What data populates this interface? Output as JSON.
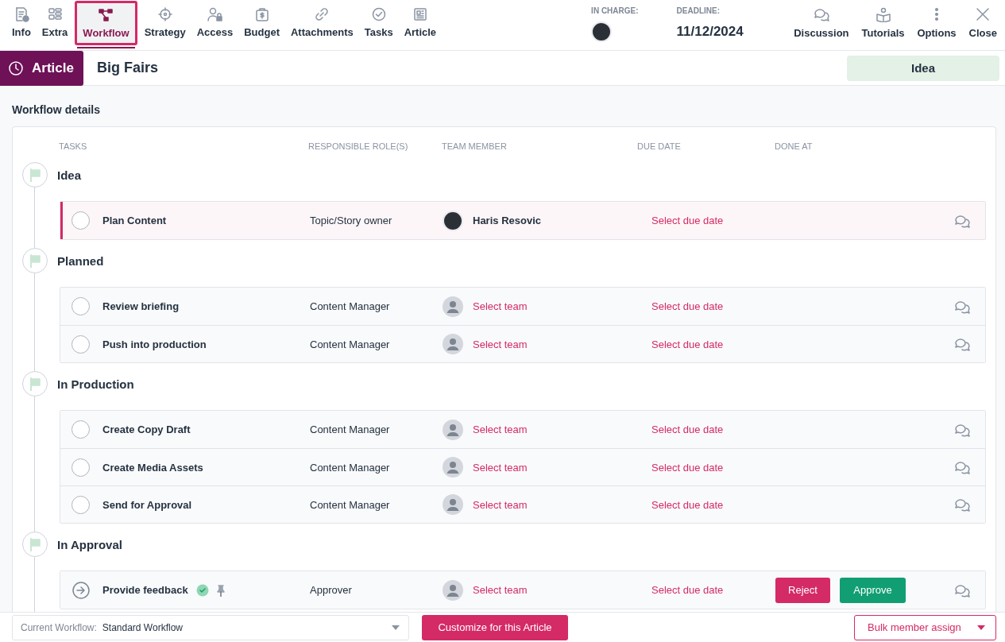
{
  "toolbar": {
    "tabs": [
      {
        "label": "Info",
        "selected": false
      },
      {
        "label": "Extra",
        "selected": false
      },
      {
        "label": "Workflow",
        "selected": true
      },
      {
        "label": "Strategy",
        "selected": false
      },
      {
        "label": "Access",
        "selected": false
      },
      {
        "label": "Budget",
        "selected": false
      },
      {
        "label": "Attachments",
        "selected": false
      },
      {
        "label": "Tasks",
        "selected": false
      },
      {
        "label": "Article",
        "selected": false
      }
    ],
    "in_charge": {
      "label": "IN CHARGE:"
    },
    "deadline": {
      "label": "DEADLINE:",
      "value": "11/12/2024"
    },
    "actions": [
      "Discussion",
      "Tutorials",
      "Options",
      "Close"
    ]
  },
  "title_bar": {
    "type": "Article",
    "title": "Big Fairs",
    "status": "Idea"
  },
  "section_title": "Workflow details",
  "columns": [
    "TASKS",
    "RESPONSIBLE ROLE(S)",
    "TEAM MEMBER",
    "DUE DATE",
    "DONE AT"
  ],
  "stages": [
    {
      "name": "Idea",
      "tasks": [
        {
          "name": "Plan Content",
          "kind": "todo",
          "active": true,
          "role": "Topic/Story owner",
          "member": "Haris Resovic",
          "assigned": true,
          "due": "Select due date"
        }
      ]
    },
    {
      "name": "Planned",
      "tasks": [
        {
          "name": "Review briefing",
          "kind": "todo",
          "active": false,
          "role": "Content Manager",
          "member": "Select team",
          "assigned": false,
          "due": "Select due date"
        },
        {
          "name": "Push into production",
          "kind": "todo",
          "active": false,
          "role": "Content Manager",
          "member": "Select team",
          "assigned": false,
          "due": "Select due date"
        }
      ]
    },
    {
      "name": "In Production",
      "tasks": [
        {
          "name": "Create Copy Draft",
          "kind": "todo",
          "active": false,
          "role": "Content Manager",
          "member": "Select team",
          "assigned": false,
          "due": "Select due date"
        },
        {
          "name": "Create Media Assets",
          "kind": "todo",
          "active": false,
          "role": "Content Manager",
          "member": "Select team",
          "assigned": false,
          "due": "Select due date"
        },
        {
          "name": "Send for Approval",
          "kind": "todo",
          "active": false,
          "role": "Content Manager",
          "member": "Select team",
          "assigned": false,
          "due": "Select due date"
        }
      ]
    },
    {
      "name": "In Approval",
      "tasks": [
        {
          "name": "Provide feedback",
          "kind": "approval",
          "active": false,
          "verified": true,
          "pinned": true,
          "role": "Approver",
          "member": "Select team",
          "assigned": false,
          "due": "Select due date",
          "buttons": [
            {
              "label": "Reject",
              "kind": "reject"
            },
            {
              "label": "Approve",
              "kind": "approve"
            }
          ]
        }
      ]
    }
  ],
  "footer": {
    "workflow_label": "Current Workflow:",
    "workflow_value": "Standard Workflow",
    "customize": "Customize for this Article",
    "bulk": "Bulk member assign"
  }
}
